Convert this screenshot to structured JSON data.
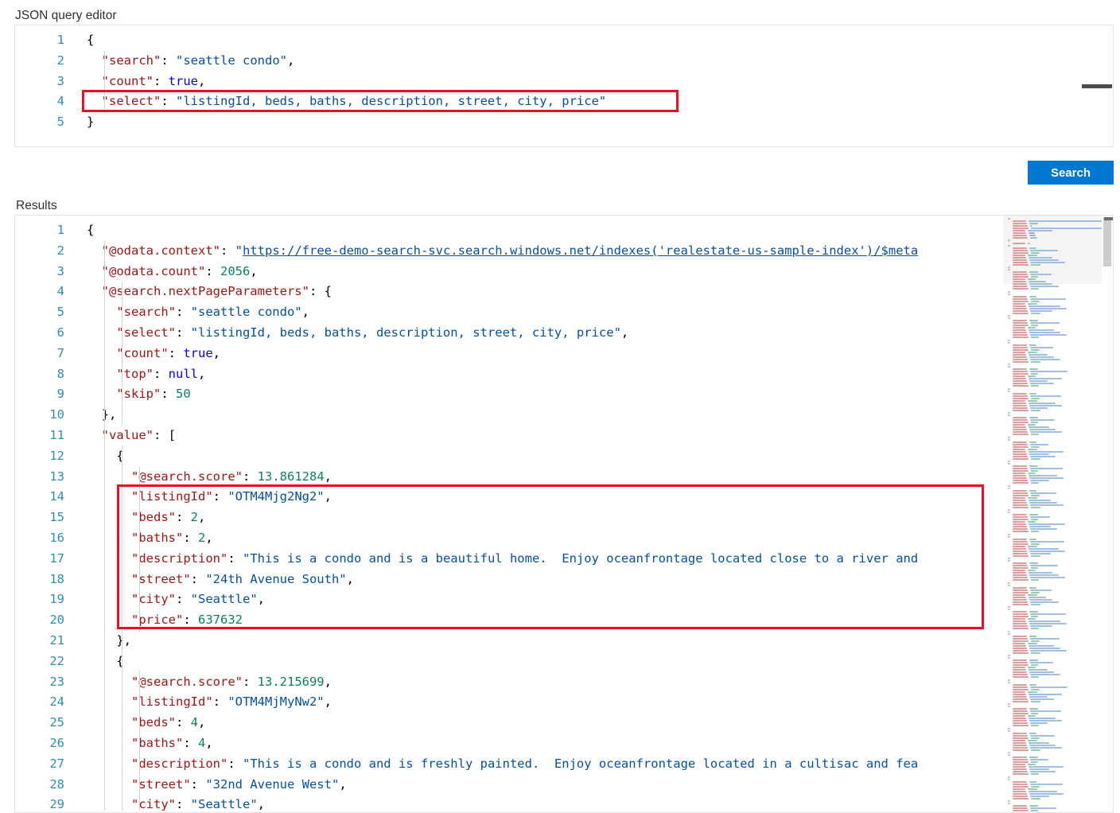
{
  "labels": {
    "query_editor": "JSON query editor",
    "results": "Results"
  },
  "toolbar": {
    "search_label": "Search"
  },
  "colors": {
    "accent": "#0078d4",
    "highlight_box": "#e81123",
    "key": "#a31515",
    "string": "#0451a5",
    "number": "#098658",
    "boolean": "#0000ff",
    "line_number": "#2b91af"
  },
  "query_editor": {
    "line_count": 5,
    "lines": [
      {
        "num": "1",
        "tokens": [
          {
            "t": "{",
            "c": "p"
          }
        ]
      },
      {
        "num": "2",
        "tokens": [
          {
            "t": "  ",
            "c": "p"
          },
          {
            "t": "\"search\"",
            "c": "k"
          },
          {
            "t": ": ",
            "c": "p"
          },
          {
            "t": "\"seattle condo\"",
            "c": "s"
          },
          {
            "t": ",",
            "c": "p"
          }
        ]
      },
      {
        "num": "3",
        "tokens": [
          {
            "t": "  ",
            "c": "p"
          },
          {
            "t": "\"count\"",
            "c": "k"
          },
          {
            "t": ": ",
            "c": "p"
          },
          {
            "t": "true",
            "c": "b"
          },
          {
            "t": ",",
            "c": "p"
          }
        ]
      },
      {
        "num": "4",
        "tokens": [
          {
            "t": "  ",
            "c": "p"
          },
          {
            "t": "\"select\"",
            "c": "k"
          },
          {
            "t": ": ",
            "c": "p"
          },
          {
            "t": "\"listingId, beds, baths, description, street, city, price\"",
            "c": "s"
          }
        ]
      },
      {
        "num": "5",
        "tokens": [
          {
            "t": "}",
            "c": "p"
          }
        ]
      }
    ],
    "highlight": {
      "line": 4,
      "description": "select clause highlighted"
    }
  },
  "results_editor": {
    "lines": [
      {
        "num": "1",
        "tokens": [
          {
            "t": "{",
            "c": "p"
          }
        ]
      },
      {
        "num": "2",
        "tokens": [
          {
            "t": "  ",
            "c": "p"
          },
          {
            "t": "\"@odata.context\"",
            "c": "k"
          },
          {
            "t": ": ",
            "c": "p"
          },
          {
            "t": "\"",
            "c": "s"
          },
          {
            "t": "https://free-demo-search-svc.search.windows.net/indexes('realestate-us-sample-index')/$meta",
            "c": "lnk"
          }
        ]
      },
      {
        "num": "3",
        "tokens": [
          {
            "t": "  ",
            "c": "p"
          },
          {
            "t": "\"@odata.count\"",
            "c": "k"
          },
          {
            "t": ": ",
            "c": "p"
          },
          {
            "t": "2056",
            "c": "n"
          },
          {
            "t": ",",
            "c": "p"
          }
        ]
      },
      {
        "num": "4",
        "tokens": [
          {
            "t": "  ",
            "c": "p"
          },
          {
            "t": "\"@search.nextPageParameters\"",
            "c": "k"
          },
          {
            "t": ": {",
            "c": "p"
          }
        ]
      },
      {
        "num": "5",
        "tokens": [
          {
            "t": "    ",
            "c": "p"
          },
          {
            "t": "\"search\"",
            "c": "k"
          },
          {
            "t": ": ",
            "c": "p"
          },
          {
            "t": "\"seattle condo\"",
            "c": "s"
          },
          {
            "t": ",",
            "c": "p"
          }
        ]
      },
      {
        "num": "6",
        "tokens": [
          {
            "t": "    ",
            "c": "p"
          },
          {
            "t": "\"select\"",
            "c": "k"
          },
          {
            "t": ": ",
            "c": "p"
          },
          {
            "t": "\"listingId, beds, baths, description, street, city, price\"",
            "c": "s"
          },
          {
            "t": ",",
            "c": "p"
          }
        ]
      },
      {
        "num": "7",
        "tokens": [
          {
            "t": "    ",
            "c": "p"
          },
          {
            "t": "\"count\"",
            "c": "k"
          },
          {
            "t": ": ",
            "c": "p"
          },
          {
            "t": "true",
            "c": "b"
          },
          {
            "t": ",",
            "c": "p"
          }
        ]
      },
      {
        "num": "8",
        "tokens": [
          {
            "t": "    ",
            "c": "p"
          },
          {
            "t": "\"top\"",
            "c": "k"
          },
          {
            "t": ": ",
            "c": "p"
          },
          {
            "t": "null",
            "c": "b"
          },
          {
            "t": ",",
            "c": "p"
          }
        ]
      },
      {
        "num": "9",
        "tokens": [
          {
            "t": "    ",
            "c": "p"
          },
          {
            "t": "\"skip\"",
            "c": "k"
          },
          {
            "t": ": ",
            "c": "p"
          },
          {
            "t": "50",
            "c": "n"
          }
        ]
      },
      {
        "num": "10",
        "tokens": [
          {
            "t": "  },",
            "c": "p"
          }
        ]
      },
      {
        "num": "11",
        "tokens": [
          {
            "t": "  ",
            "c": "p"
          },
          {
            "t": "\"value\"",
            "c": "k"
          },
          {
            "t": ": [",
            "c": "p"
          }
        ]
      },
      {
        "num": "12",
        "tokens": [
          {
            "t": "    {",
            "c": "p"
          }
        ]
      },
      {
        "num": "13",
        "tokens": [
          {
            "t": "      ",
            "c": "p"
          },
          {
            "t": "\"@search.score\"",
            "c": "k"
          },
          {
            "t": ": ",
            "c": "p"
          },
          {
            "t": "13.861284",
            "c": "n"
          },
          {
            "t": ",",
            "c": "p"
          }
        ]
      },
      {
        "num": "14",
        "tokens": [
          {
            "t": "      ",
            "c": "p"
          },
          {
            "t": "\"listingId\"",
            "c": "k"
          },
          {
            "t": ": ",
            "c": "p"
          },
          {
            "t": "\"OTM4Mjg2Ng2\"",
            "c": "s"
          },
          {
            "t": ",",
            "c": "p"
          }
        ]
      },
      {
        "num": "15",
        "tokens": [
          {
            "t": "      ",
            "c": "p"
          },
          {
            "t": "\"beds\"",
            "c": "k"
          },
          {
            "t": ": ",
            "c": "p"
          },
          {
            "t": "2",
            "c": "n"
          },
          {
            "t": ",",
            "c": "p"
          }
        ]
      },
      {
        "num": "16",
        "tokens": [
          {
            "t": "      ",
            "c": "p"
          },
          {
            "t": "\"baths\"",
            "c": "k"
          },
          {
            "t": ": ",
            "c": "p"
          },
          {
            "t": "2",
            "c": "n"
          },
          {
            "t": ",",
            "c": "p"
          }
        ]
      },
      {
        "num": "17",
        "tokens": [
          {
            "t": "      ",
            "c": "p"
          },
          {
            "t": "\"description\"",
            "c": "k"
          },
          {
            "t": ": ",
            "c": "p"
          },
          {
            "t": "\"This is a condo and is a beautiful home.  Enjoy oceanfrontage located close to a river and",
            "c": "s"
          }
        ]
      },
      {
        "num": "18",
        "tokens": [
          {
            "t": "      ",
            "c": "p"
          },
          {
            "t": "\"street\"",
            "c": "k"
          },
          {
            "t": ": ",
            "c": "p"
          },
          {
            "t": "\"24th Avenue South\"",
            "c": "s"
          },
          {
            "t": ",",
            "c": "p"
          }
        ]
      },
      {
        "num": "19",
        "tokens": [
          {
            "t": "      ",
            "c": "p"
          },
          {
            "t": "\"city\"",
            "c": "k"
          },
          {
            "t": ": ",
            "c": "p"
          },
          {
            "t": "\"Seattle\"",
            "c": "s"
          },
          {
            "t": ",",
            "c": "p"
          }
        ]
      },
      {
        "num": "20",
        "tokens": [
          {
            "t": "      ",
            "c": "p"
          },
          {
            "t": "\"price\"",
            "c": "k"
          },
          {
            "t": ": ",
            "c": "p"
          },
          {
            "t": "637632",
            "c": "n"
          }
        ]
      },
      {
        "num": "21",
        "tokens": [
          {
            "t": "    },",
            "c": "p"
          }
        ]
      },
      {
        "num": "22",
        "tokens": [
          {
            "t": "    {",
            "c": "p"
          }
        ]
      },
      {
        "num": "23",
        "tokens": [
          {
            "t": "      ",
            "c": "p"
          },
          {
            "t": "\"@search.score\"",
            "c": "k"
          },
          {
            "t": ": ",
            "c": "p"
          },
          {
            "t": "13.215699",
            "c": "n"
          },
          {
            "t": ",",
            "c": "p"
          }
        ]
      },
      {
        "num": "24",
        "tokens": [
          {
            "t": "      ",
            "c": "p"
          },
          {
            "t": "\"listingId\"",
            "c": "k"
          },
          {
            "t": ": ",
            "c": "p"
          },
          {
            "t": "\"OTM4MjMyNw2\"",
            "c": "s"
          },
          {
            "t": ",",
            "c": "p"
          }
        ]
      },
      {
        "num": "25",
        "tokens": [
          {
            "t": "      ",
            "c": "p"
          },
          {
            "t": "\"beds\"",
            "c": "k"
          },
          {
            "t": ": ",
            "c": "p"
          },
          {
            "t": "4",
            "c": "n"
          },
          {
            "t": ",",
            "c": "p"
          }
        ]
      },
      {
        "num": "26",
        "tokens": [
          {
            "t": "      ",
            "c": "p"
          },
          {
            "t": "\"baths\"",
            "c": "k"
          },
          {
            "t": ": ",
            "c": "p"
          },
          {
            "t": "4",
            "c": "n"
          },
          {
            "t": ",",
            "c": "p"
          }
        ]
      },
      {
        "num": "27",
        "tokens": [
          {
            "t": "      ",
            "c": "p"
          },
          {
            "t": "\"description\"",
            "c": "k"
          },
          {
            "t": ": ",
            "c": "p"
          },
          {
            "t": "\"This is a condo and is freshly painted.  Enjoy oceanfrontage located in a cultisac and fea",
            "c": "s"
          }
        ]
      },
      {
        "num": "28",
        "tokens": [
          {
            "t": "      ",
            "c": "p"
          },
          {
            "t": "\"street\"",
            "c": "k"
          },
          {
            "t": ": ",
            "c": "p"
          },
          {
            "t": "\"32nd Avenue West\"",
            "c": "s"
          },
          {
            "t": ",",
            "c": "p"
          }
        ]
      },
      {
        "num": "29",
        "tokens": [
          {
            "t": "      ",
            "c": "p"
          },
          {
            "t": "\"city\"",
            "c": "k"
          },
          {
            "t": ": ",
            "c": "p"
          },
          {
            "t": "\"Seattle\"",
            "c": "s"
          },
          {
            "t": ",",
            "c": "p"
          }
        ]
      }
    ],
    "highlight": {
      "from_line": 14,
      "to_line": 20,
      "description": "selected fields of first result highlighted"
    }
  }
}
